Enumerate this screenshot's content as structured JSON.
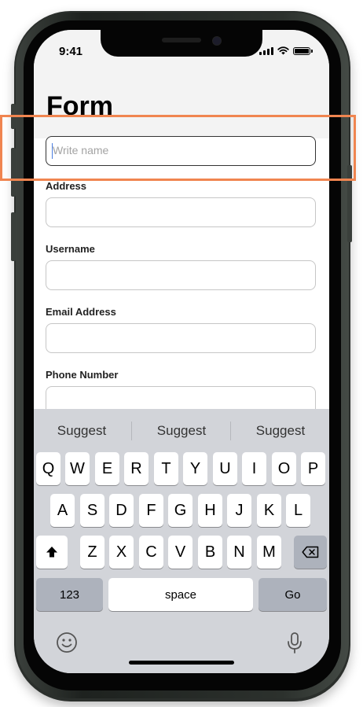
{
  "status_bar": {
    "time": "9:41"
  },
  "page": {
    "title": "Form"
  },
  "fields": [
    {
      "label": "",
      "value": "",
      "placeholder": "Write name"
    },
    {
      "label": "Address",
      "value": "",
      "placeholder": ""
    },
    {
      "label": "Username",
      "value": "",
      "placeholder": ""
    },
    {
      "label": "Email Address",
      "value": "",
      "placeholder": ""
    },
    {
      "label": "Phone Number",
      "value": "",
      "placeholder": ""
    }
  ],
  "keyboard": {
    "suggestions": [
      "Suggest",
      "Suggest",
      "Suggest"
    ],
    "row1": [
      "Q",
      "W",
      "E",
      "R",
      "T",
      "Y",
      "U",
      "I",
      "O",
      "P"
    ],
    "row2": [
      "A",
      "S",
      "D",
      "F",
      "G",
      "H",
      "J",
      "K",
      "L"
    ],
    "row3": [
      "Z",
      "X",
      "C",
      "V",
      "B",
      "N",
      "M"
    ],
    "numbers_label": "123",
    "space_label": "space",
    "go_label": "Go",
    "shift_icon": "shift-icon",
    "delete_icon": "delete-icon",
    "emoji_icon": "emoji-icon",
    "mic_icon": "microphone-icon"
  },
  "colors": {
    "highlight": "#f08550",
    "caret": "#4a7de0",
    "keyboard_bg": "#d2d4d9"
  }
}
